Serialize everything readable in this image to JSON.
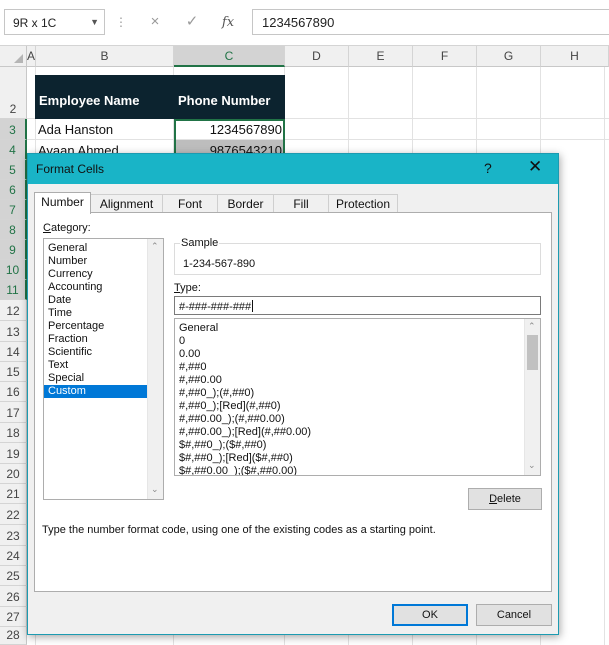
{
  "formula_bar": {
    "name_box": "9R x 1C",
    "cancel_icon": "×",
    "enter_icon": "✓",
    "fx_label": "fx",
    "value": "1234567890"
  },
  "columns": [
    "A",
    "B",
    "C",
    "D",
    "E",
    "F",
    "G",
    "H"
  ],
  "rows": [
    "2",
    "3",
    "4",
    "5",
    "6",
    "7",
    "8",
    "9",
    "10",
    "11",
    "12",
    "13",
    "14",
    "15",
    "16",
    "17",
    "18",
    "19",
    "20",
    "21",
    "22",
    "23",
    "24",
    "25",
    "26",
    "27",
    "28"
  ],
  "sheet": {
    "header_b": "Employee Name",
    "header_c": "Phone Number",
    "b3": "Ada Hanston",
    "c3": "1234567890",
    "b4": "Ayaan Ahmed",
    "c4": "9876543210"
  },
  "dialog": {
    "title": "Format Cells",
    "help": "?",
    "close": "✕",
    "tabs": [
      "Number",
      "Alignment",
      "Font",
      "Border",
      "Fill",
      "Protection"
    ],
    "category_label_first": "C",
    "category_label_rest": "ategory:",
    "categories": [
      "General",
      "Number",
      "Currency",
      "Accounting",
      "Date",
      "Time",
      "Percentage",
      "Fraction",
      "Scientific",
      "Text",
      "Special",
      "Custom"
    ],
    "selected_category": "Custom",
    "sample_label": "Sample",
    "sample_value": "1-234-567-890",
    "type_label_first": "T",
    "type_label_rest": "ype:",
    "type_value": "#-###-###-###",
    "formats": [
      "General",
      "0",
      "0.00",
      "#,##0",
      "#,##0.00",
      "#,##0_);(#,##0)",
      "#,##0_);[Red](#,##0)",
      "#,##0.00_);(#,##0.00)",
      "#,##0.00_);[Red](#,##0.00)",
      "$#,##0_);($#,##0)",
      "$#,##0_);[Red]($#,##0)",
      "$#,##0.00_);($#,##0.00)"
    ],
    "delete_first": "D",
    "delete_rest": "elete",
    "hint": "Type the number format code, using one of the existing codes as a starting point.",
    "ok": "OK",
    "cancel": "Cancel",
    "scroll_up": "⌃",
    "scroll_down": "⌄"
  }
}
